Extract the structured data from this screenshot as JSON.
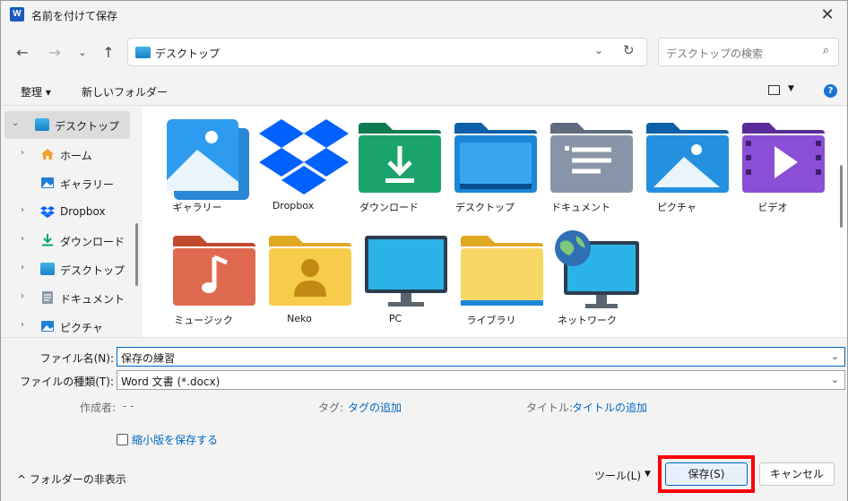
{
  "window": {
    "title": "名前を付けて保存",
    "app_icon_letter": "W"
  },
  "address": {
    "location": "デスクトップ",
    "search_placeholder": "デスクトップの検索"
  },
  "toolbar": {
    "organize": "整理 ▾",
    "new_folder": "新しいフォルダー"
  },
  "sidebar": {
    "items": [
      {
        "label": "デスクトップ",
        "icon": "desktop-icon"
      },
      {
        "label": "ホーム",
        "icon": "home-icon"
      },
      {
        "label": "ギャラリー",
        "icon": "gallery-icon"
      },
      {
        "label": "Dropbox",
        "icon": "dropbox-icon"
      },
      {
        "label": "ダウンロード",
        "icon": "download-icon"
      },
      {
        "label": "デスクトップ",
        "icon": "desktop-icon"
      },
      {
        "label": "ドキュメント",
        "icon": "documents-icon"
      },
      {
        "label": "ピクチャ",
        "icon": "pictures-icon"
      }
    ]
  },
  "files": [
    {
      "label": "ギャラリー",
      "icon": "gallery-icon"
    },
    {
      "label": "Dropbox",
      "icon": "dropbox-icon"
    },
    {
      "label": "ダウンロード",
      "icon": "download-folder-icon"
    },
    {
      "label": "デスクトップ",
      "icon": "desktop-folder-icon"
    },
    {
      "label": "ドキュメント",
      "icon": "documents-folder-icon"
    },
    {
      "label": "ピクチャ",
      "icon": "pictures-folder-icon"
    },
    {
      "label": "ビデオ",
      "icon": "videos-folder-icon"
    },
    {
      "label": "ミュージック",
      "icon": "music-folder-icon"
    },
    {
      "label": "Neko",
      "icon": "user-folder-icon"
    },
    {
      "label": "PC",
      "icon": "pc-icon"
    },
    {
      "label": "ライブラリ",
      "icon": "library-folder-icon"
    },
    {
      "label": "ネットワーク",
      "icon": "network-icon"
    }
  ],
  "form": {
    "filename_label": "ファイル名(N):",
    "filename_value": "保存の練習",
    "filetype_label": "ファイルの種類(T):",
    "filetype_value": "Word 文書 (*.docx)",
    "author_label": "作成者:",
    "author_value": "- -",
    "tags_label": "タグ:",
    "tags_link": "タグの追加",
    "title_label": "タイトル:",
    "title_link": "タイトルの追加",
    "thumbnail_label": "縮小版を保存する"
  },
  "footer": {
    "hide_folders": "フォルダーの非表示",
    "tools": "ツール(L)",
    "save": "保存(S)",
    "cancel": "キャンセル"
  },
  "colors": {
    "accent": "#0067c0",
    "highlight_box": "#ff0000"
  }
}
